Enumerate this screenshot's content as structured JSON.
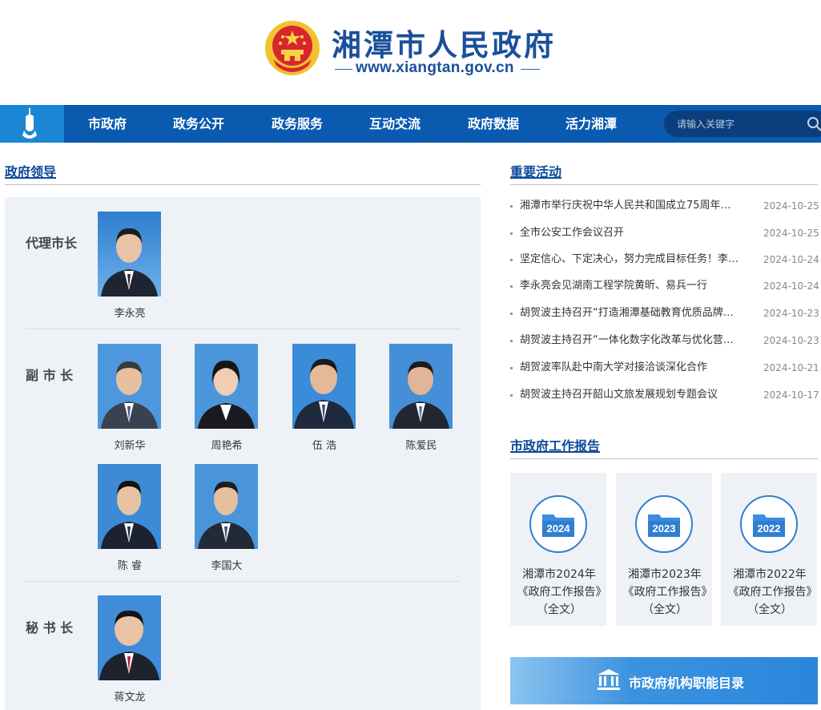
{
  "header": {
    "site_title": "湘潭市人民政府",
    "site_url": "www.xiangtan.gov.cn"
  },
  "nav": {
    "items": [
      "市政府",
      "政务公开",
      "政务服务",
      "互动交流",
      "政府数据",
      "活力湘潭"
    ],
    "search_placeholder": "请输入关键字"
  },
  "leaders": {
    "section_title": "政府领导",
    "groups": [
      {
        "role": "代理市长",
        "people": [
          "李永亮"
        ]
      },
      {
        "role": "副 市 长",
        "people": [
          "刘新华",
          "周艳希",
          "伍  浩",
          "陈爱民",
          "陈  睿",
          "李国大"
        ]
      },
      {
        "role": "秘 书 长",
        "people": [
          "蒋文龙"
        ]
      }
    ]
  },
  "activities": {
    "section_title": "重要活动",
    "items": [
      {
        "title": "湘潭市举行庆祝中华人民共和国成立75周年…",
        "date": "2024-10-25"
      },
      {
        "title": "全市公安工作会议召开",
        "date": "2024-10-25"
      },
      {
        "title": "坚定信心、下定决心，努力完成目标任务！李…",
        "date": "2024-10-24"
      },
      {
        "title": "李永亮会见湖南工程学院黄昕、易兵一行",
        "date": "2024-10-24"
      },
      {
        "title": "胡贺波主持召开“打造湘潭基础教育优质品牌…",
        "date": "2024-10-23"
      },
      {
        "title": "胡贺波主持召开“一体化数字化改革与优化营…",
        "date": "2024-10-23"
      },
      {
        "title": "胡贺波率队赴中南大学对接洽谈深化合作",
        "date": "2024-10-21"
      },
      {
        "title": "胡贺波主持召开韶山文旅发展规划专题会议",
        "date": "2024-10-17"
      }
    ]
  },
  "reports": {
    "section_title": "市政府工作报告",
    "items": [
      {
        "year": "2024",
        "text": "湘潭市2024年《政府工作报告》（全文）"
      },
      {
        "year": "2023",
        "text": "湘潭市2023年《政府工作报告》（全文）"
      },
      {
        "year": "2022",
        "text": "湘潭市2022年《政府工作报告》（全文）"
      }
    ]
  },
  "banner": {
    "label": "市政府机构职能目录"
  },
  "colors": {
    "primary": "#0a5ab0",
    "accent": "#0b4a9a",
    "panel": "#eef2f7"
  }
}
